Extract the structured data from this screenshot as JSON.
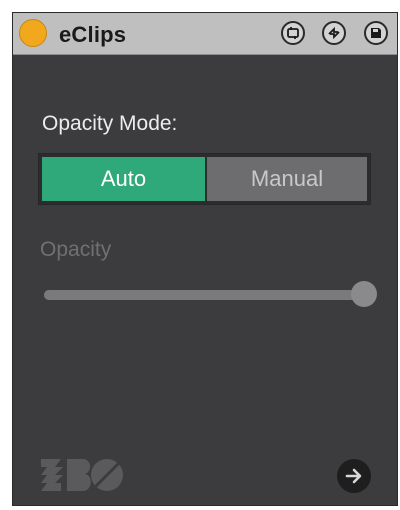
{
  "window": {
    "title": "eClips"
  },
  "titlebar": {
    "buttons": [
      {
        "icon": "loop-icon"
      },
      {
        "icon": "swap-arrows-icon"
      },
      {
        "icon": "save-icon"
      }
    ]
  },
  "opacity_mode": {
    "label": "Opacity Mode:",
    "options": [
      "Auto",
      "Manual"
    ],
    "selected": "Auto"
  },
  "opacity": {
    "label": "Opacity",
    "value_fraction": 1.0,
    "enabled": false
  },
  "footer": {
    "logo_icon": "ebo-logo-icon",
    "next_icon": "arrow-right-icon"
  },
  "colors": {
    "accent": "#2fa87a",
    "device_indicator": "#f2a81d",
    "panel_bg": "#3c3c3e",
    "titlebar_bg": "#bfbfbf"
  }
}
